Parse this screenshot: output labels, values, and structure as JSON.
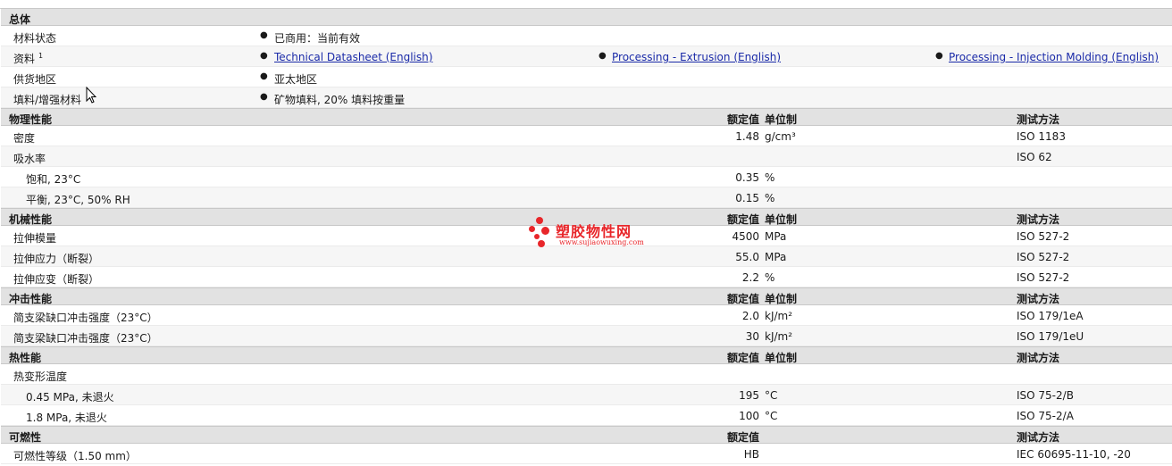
{
  "general": {
    "title": "总体",
    "rows": [
      {
        "label": "材料状态",
        "value": "已商用：当前有效"
      },
      {
        "label": "资料",
        "sup": "1",
        "links": [
          "Technical Datasheet (English)",
          "Processing - Extrusion (English)",
          "Processing - Injection Molding (English)"
        ]
      },
      {
        "label": "供货地区",
        "value": "亚太地区"
      },
      {
        "label": "填料/增强材料",
        "value": "矿物填料, 20% 填料按重量"
      }
    ]
  },
  "headers": {
    "nominal": "额定值",
    "unit": "单位制",
    "method": "测试方法"
  },
  "physical": {
    "title": "物理性能",
    "rows": [
      {
        "label": "密度",
        "value": "1.48",
        "unit": "g/cm³",
        "method": "ISO 1183"
      },
      {
        "label": "吸水率",
        "value": "",
        "unit": "",
        "method": "ISO 62"
      },
      {
        "label": "饱和, 23°C",
        "value": "0.35",
        "unit": "%",
        "method": ""
      },
      {
        "label": "平衡, 23°C, 50% RH",
        "value": "0.15",
        "unit": "%",
        "method": ""
      }
    ]
  },
  "mechanical": {
    "title": "机械性能",
    "rows": [
      {
        "label": "拉伸模量",
        "value": "4500",
        "unit": "MPa",
        "method": "ISO 527-2"
      },
      {
        "label": "拉伸应力（断裂）",
        "value": "55.0",
        "unit": "MPa",
        "method": "ISO 527-2"
      },
      {
        "label": "拉伸应变（断裂）",
        "value": "2.2",
        "unit": "%",
        "method": "ISO 527-2"
      }
    ]
  },
  "impact": {
    "title": "冲击性能",
    "rows": [
      {
        "label": "简支梁缺口冲击强度（23°C）",
        "value": "2.0",
        "unit": "kJ/m²",
        "method": "ISO 179/1eA"
      },
      {
        "label": "简支梁缺口冲击强度（23°C）",
        "value": "30",
        "unit": "kJ/m²",
        "method": "ISO 179/1eU"
      }
    ]
  },
  "thermal": {
    "title": "热性能",
    "rows": [
      {
        "label": "热变形温度",
        "value": "",
        "unit": "",
        "method": ""
      },
      {
        "label": "0.45 MPa, 未退火",
        "value": "195",
        "unit": "°C",
        "method": "ISO 75-2/B"
      },
      {
        "label": "1.8 MPa, 未退火",
        "value": "100",
        "unit": "°C",
        "method": "ISO 75-2/A"
      }
    ]
  },
  "flammability": {
    "title": "可燃性",
    "rows": [
      {
        "label": "可燃性等级（1.50 mm）",
        "value": "HB",
        "unit": "",
        "method": "IEC 60695-11-10, -20"
      }
    ]
  },
  "watermark": {
    "name": "塑胶物性网",
    "url": "www.sujiaowuxing.com"
  },
  "colors": {
    "section_bg": "#e2e2e2",
    "link": "#1a2aa8",
    "watermark": "#e8262a"
  }
}
